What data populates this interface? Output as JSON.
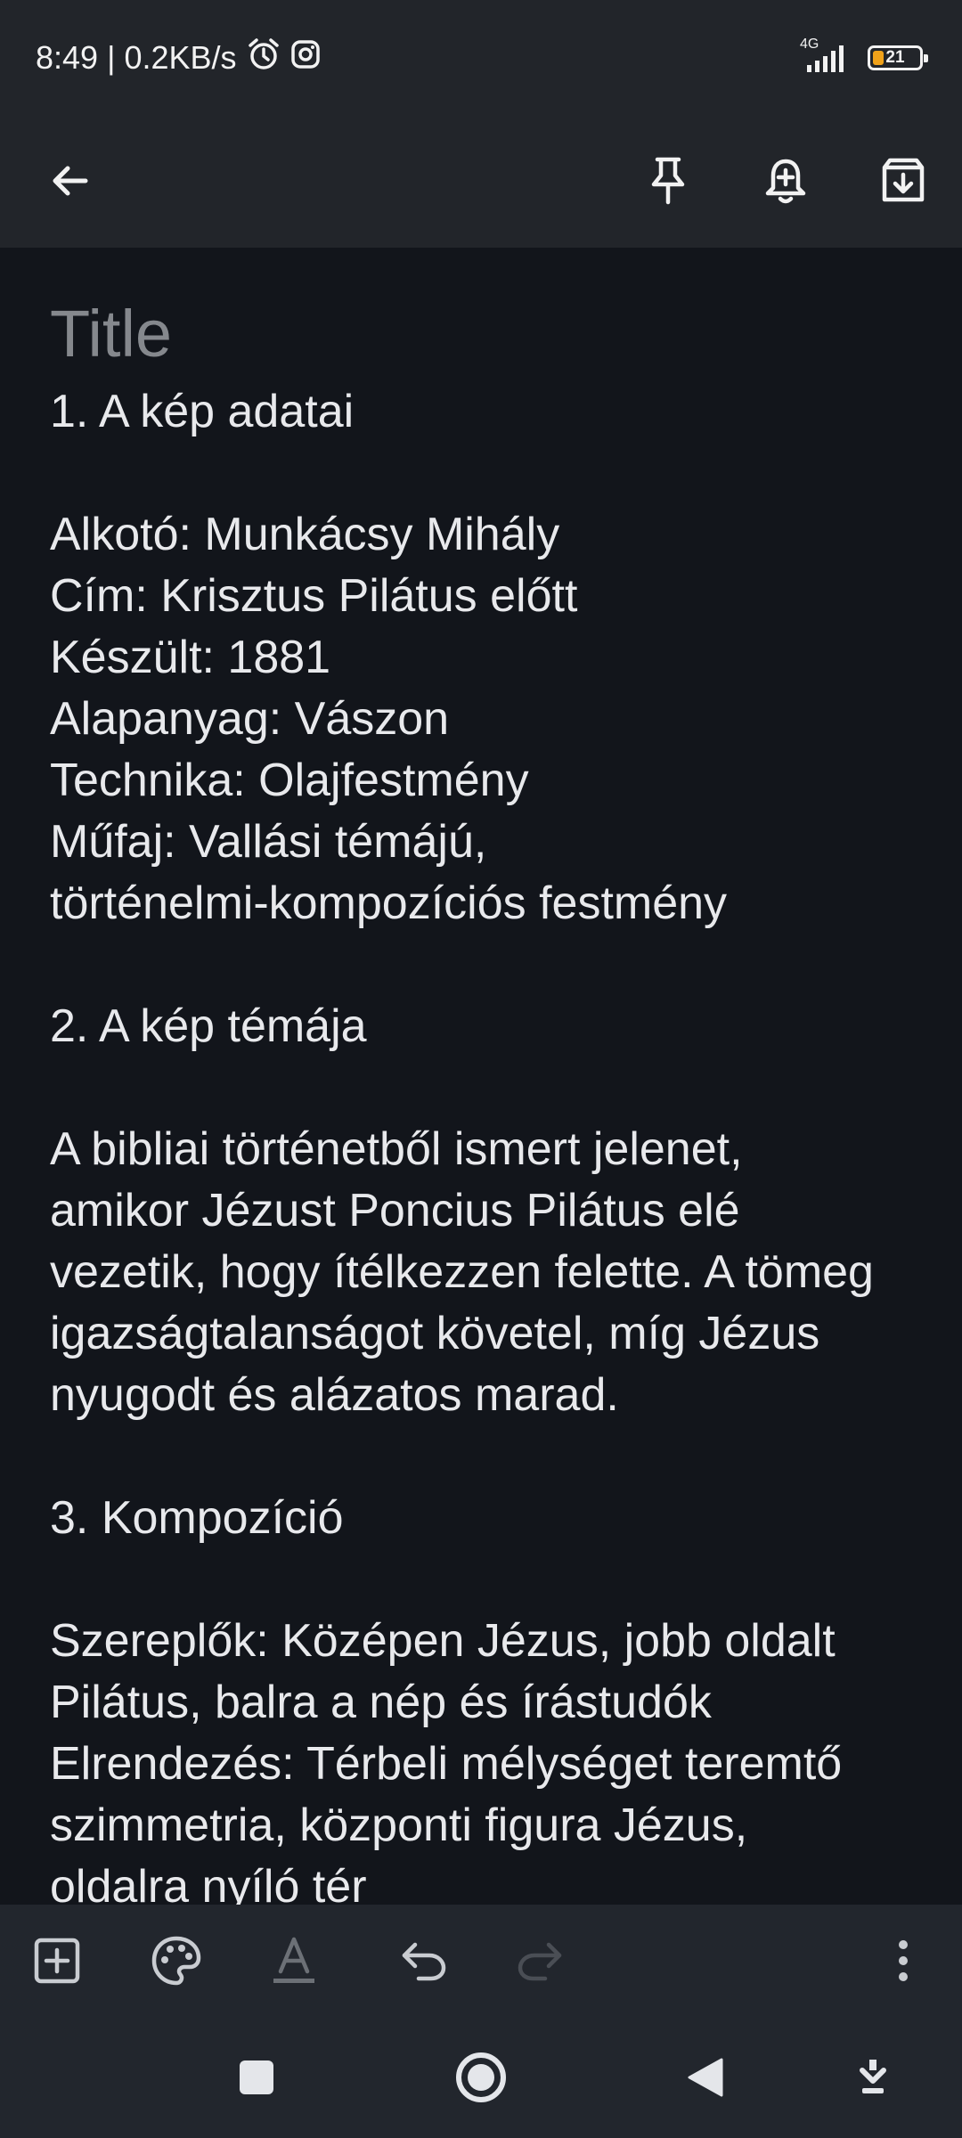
{
  "status_bar": {
    "time": "8:49",
    "separator": "|",
    "speed": "0.2KB/s",
    "network": "4G",
    "battery": "21",
    "icons": [
      "alarm-icon",
      "instagram-icon",
      "signal-icon",
      "battery-icon"
    ]
  },
  "app_bar": {
    "icons": [
      "back-arrow-icon",
      "pin-icon",
      "add-reminder-icon",
      "archive-icon"
    ]
  },
  "note": {
    "title_placeholder": "Title",
    "lines": [
      "1. A kép adatai",
      "",
      "Alkotó: Munkácsy Mihály",
      "Cím: Krisztus Pilátus előtt",
      "Készült: 1881",
      "Alapanyag: Vászon",
      "Technika: Olajfestmény",
      "Műfaj: Vallási témájú,",
      "történelmi-kompozíciós festmény",
      "",
      "2. A kép témája",
      "",
      "A bibliai történetből ismert jelenet,",
      "amikor Jézust Poncius Pilátus elé",
      "vezetik, hogy ítélkezzen felette. A tömeg",
      "igazságtalanságot követel, míg Jézus",
      "nyugodt és alázatos marad.",
      "",
      "3. Kompozíció",
      "",
      "Szereplők: Középen Jézus, jobb oldalt",
      "Pilátus, balra a nép és írástudók",
      "Elrendezés: Térbeli mélységet teremtő",
      "szimmetria, központi figura Jézus,",
      "oldalra nyíló tér"
    ]
  },
  "bottom_toolbar": {
    "icons": [
      "add-box-icon",
      "palette-icon",
      "text-format-icon",
      "undo-icon",
      "redo-icon",
      "more-vert-icon"
    ]
  },
  "nav_bar": {
    "icons": [
      "recents-square-icon",
      "home-circle-icon",
      "back-triangle-icon",
      "keyboard-hide-icon"
    ]
  },
  "colors": {
    "background": "#12151b",
    "bars": "#22252a",
    "text": "#e8e9ec",
    "placeholder": "#85888d",
    "battery_fill": "#f0a21a"
  }
}
